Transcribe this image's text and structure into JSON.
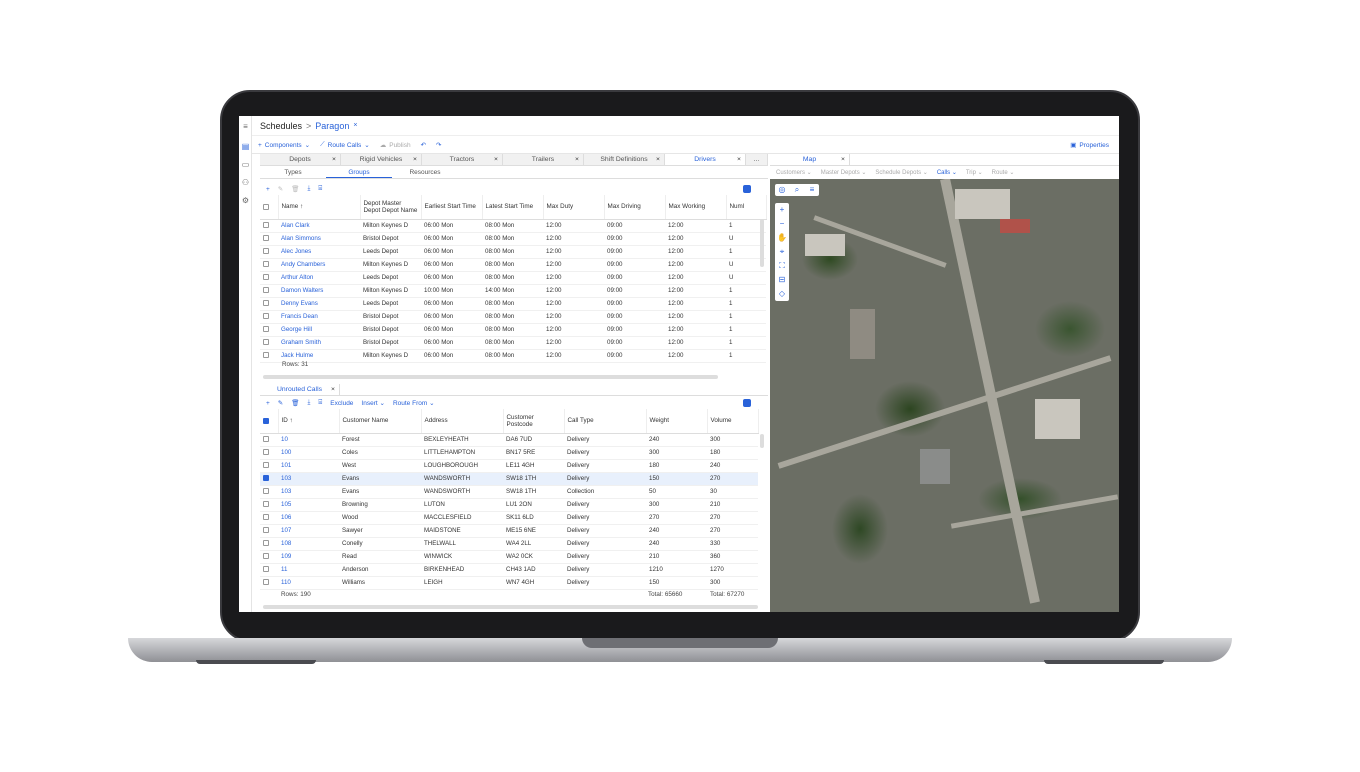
{
  "breadcrumb": {
    "root": "Schedules",
    "current": "Paragon"
  },
  "toolbar": {
    "components": "Components",
    "route_calls": "Route Calls",
    "publish": "Publish",
    "properties": "Properties"
  },
  "top_tabs": [
    {
      "label": "Depots"
    },
    {
      "label": "Rigid Vehicles"
    },
    {
      "label": "Tractors"
    },
    {
      "label": "Trailers"
    },
    {
      "label": "Shift Definitions"
    },
    {
      "label": "Drivers"
    },
    {
      "label": "..."
    }
  ],
  "driver_subtabs": [
    {
      "label": "Types"
    },
    {
      "label": "Groups"
    },
    {
      "label": "Resources"
    }
  ],
  "drivers": {
    "headers": [
      "Name",
      "Depot Master Depot Depot Name",
      "Earliest Start Time",
      "Latest Start Time",
      "Max Duty",
      "Max Driving",
      "Max Working",
      "Numl"
    ],
    "rows": [
      [
        "Alan Clark",
        "Milton Keynes D",
        "06:00 Mon",
        "08:00 Mon",
        "12:00",
        "09:00",
        "12:00",
        "1"
      ],
      [
        "Alan Simmons",
        "Bristol Depot",
        "06:00 Mon",
        "08:00 Mon",
        "12:00",
        "09:00",
        "12:00",
        "U"
      ],
      [
        "Alec Jones",
        "Leeds Depot",
        "06:00 Mon",
        "08:00 Mon",
        "12:00",
        "09:00",
        "12:00",
        "1"
      ],
      [
        "Andy Chambers",
        "Milton Keynes D",
        "06:00 Mon",
        "08:00 Mon",
        "12:00",
        "09:00",
        "12:00",
        "U"
      ],
      [
        "Arthur Alton",
        "Leeds Depot",
        "06:00 Mon",
        "08:00 Mon",
        "12:00",
        "09:00",
        "12:00",
        "U"
      ],
      [
        "Damon Walters",
        "Milton Keynes D",
        "10:00 Mon",
        "14:00 Mon",
        "12:00",
        "09:00",
        "12:00",
        "1"
      ],
      [
        "Denny Evans",
        "Leeds Depot",
        "06:00 Mon",
        "08:00 Mon",
        "12:00",
        "09:00",
        "12:00",
        "1"
      ],
      [
        "Francis Dean",
        "Bristol Depot",
        "06:00 Mon",
        "08:00 Mon",
        "12:00",
        "09:00",
        "12:00",
        "1"
      ],
      [
        "George Hill",
        "Bristol Depot",
        "06:00 Mon",
        "08:00 Mon",
        "12:00",
        "09:00",
        "12:00",
        "1"
      ],
      [
        "Graham Smith",
        "Bristol Depot",
        "06:00 Mon",
        "08:00 Mon",
        "12:00",
        "09:00",
        "12:00",
        "1"
      ],
      [
        "Jack Hulme",
        "Milton Keynes D",
        "06:00 Mon",
        "08:00 Mon",
        "12:00",
        "09:00",
        "12:00",
        "1"
      ]
    ],
    "rows_label": "Rows:",
    "rows_count": "31"
  },
  "unrouted": {
    "tab": "Unrouted Calls",
    "toolbar": {
      "exclude": "Exclude",
      "insert": "Insert",
      "route_from": "Route From"
    },
    "headers": [
      "ID",
      "Customer Name",
      "Address",
      "Customer Postcode",
      "Call Type",
      "Weight",
      "Volume"
    ],
    "rows": [
      [
        "10",
        "Forest",
        "BEXLEYHEATH",
        "DA6 7UD",
        "Delivery",
        "240",
        "300"
      ],
      [
        "100",
        "Coles",
        "LITTLEHAMPTON",
        "BN17 5RE",
        "Delivery",
        "300",
        "180"
      ],
      [
        "101",
        "West",
        "LOUGHBOROUGH",
        "LE11 4GH",
        "Delivery",
        "180",
        "240"
      ],
      [
        "103",
        "Evans",
        "WANDSWORTH",
        "SW18 1TH",
        "Delivery",
        "150",
        "270"
      ],
      [
        "103",
        "Evans",
        "WANDSWORTH",
        "SW18 1TH",
        "Collection",
        "50",
        "30"
      ],
      [
        "105",
        "Browning",
        "LUTON",
        "LU1 2ON",
        "Delivery",
        "300",
        "210"
      ],
      [
        "106",
        "Wood",
        "MACCLESFIELD",
        "SK11 6LD",
        "Delivery",
        "270",
        "270"
      ],
      [
        "107",
        "Sawyer",
        "MAIDSTONE",
        "ME15 6NE",
        "Delivery",
        "240",
        "270"
      ],
      [
        "108",
        "Conelly",
        "THELWALL",
        "WA4 2LL",
        "Delivery",
        "240",
        "330"
      ],
      [
        "109",
        "Read",
        "WINWICK",
        "WA2 0CK",
        "Delivery",
        "210",
        "360"
      ],
      [
        "11",
        "Anderson",
        "BIRKENHEAD",
        "CH43 1AD",
        "Delivery",
        "1210",
        "1270"
      ],
      [
        "110",
        "Williams",
        "LEIGH",
        "WN7 4GH",
        "Delivery",
        "150",
        "300"
      ]
    ],
    "selected_index": 3,
    "rows_label": "Rows:",
    "rows_count": "190",
    "total_label": "Total:",
    "total_weight": "65660",
    "total_volume": "67270"
  },
  "map": {
    "tab": "Map",
    "filters": [
      {
        "label": "Customers",
        "active": false
      },
      {
        "label": "Master Depots",
        "active": false
      },
      {
        "label": "Schedule Depots",
        "active": false
      },
      {
        "label": "Calls",
        "active": true
      },
      {
        "label": "Trip",
        "active": false
      },
      {
        "label": "Route",
        "active": false
      }
    ]
  },
  "colors": {
    "accent": "#2962d9"
  }
}
